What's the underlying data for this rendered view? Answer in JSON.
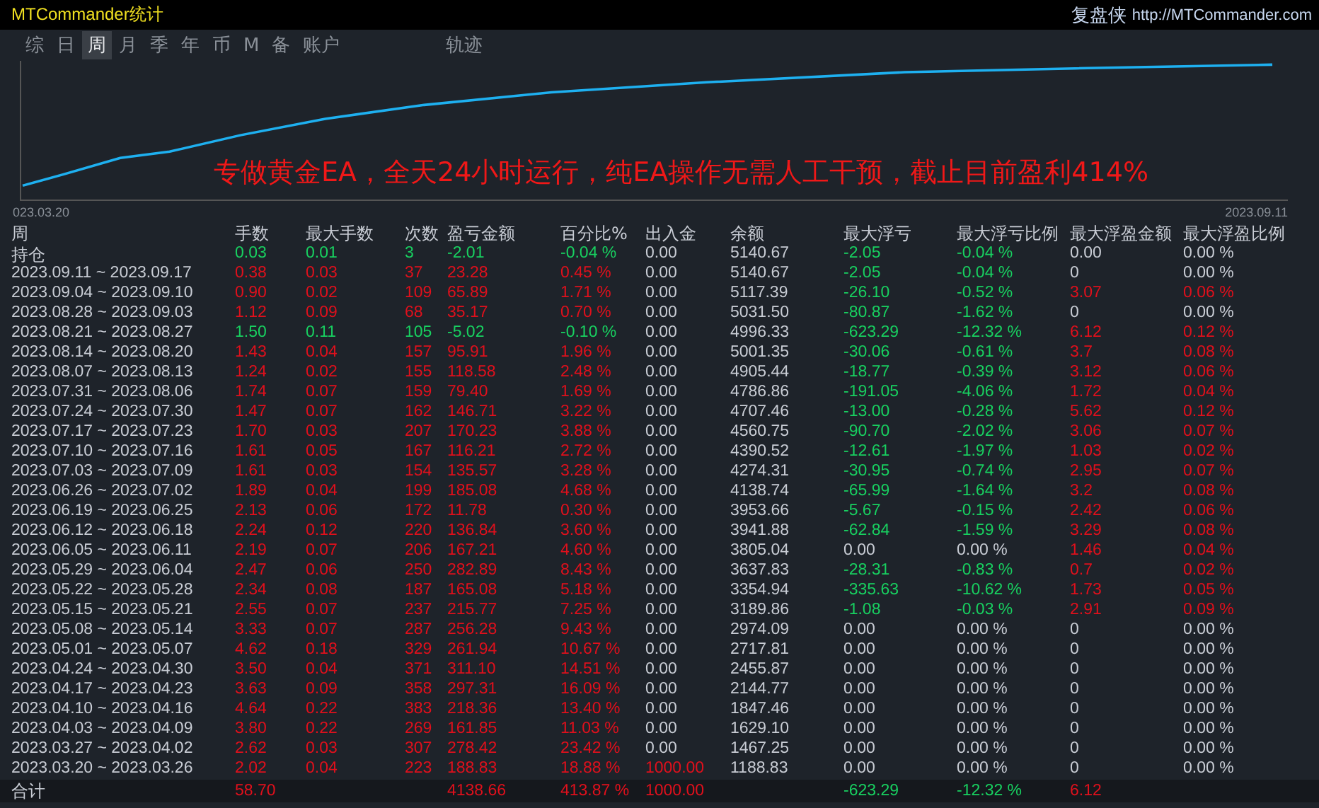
{
  "window": {
    "title": "MTCommander统计",
    "brand": "复盘侠",
    "url": "http://MTCommander.com"
  },
  "tabs": [
    {
      "label": "综",
      "selected": false
    },
    {
      "label": "日",
      "selected": false
    },
    {
      "label": "周",
      "selected": true
    },
    {
      "label": "月",
      "selected": false
    },
    {
      "label": "季",
      "selected": false
    },
    {
      "label": "年",
      "selected": false
    },
    {
      "label": "币",
      "selected": false
    },
    {
      "label": "M",
      "selected": false
    },
    {
      "label": "备",
      "selected": false
    },
    {
      "label": "账户",
      "selected": false
    },
    {
      "label": "轨迹",
      "selected": false
    }
  ],
  "chart": {
    "start_label": "023.03.20",
    "end_label": "2023.09.11",
    "banner": "专做黄金EA，全天24小时运行，纯EA操作无需人工干预，截止目前盈利414%"
  },
  "table": {
    "period_header": "周",
    "columns": [
      "手数",
      "最大手数",
      "次数",
      "盈亏金额",
      "百分比%",
      "出入金",
      "余额",
      "最大浮亏",
      "最大浮亏比例",
      "最大浮盈金额",
      "最大浮盈比例"
    ],
    "rows": [
      {
        "period": "持仓",
        "cells": [
          {
            "text": "0.03",
            "color": "#18d060"
          },
          {
            "text": "0.01",
            "color": "#18d060"
          },
          {
            "text": "3",
            "color": "#18d060"
          },
          {
            "text": "-2.01",
            "color": "#18d060"
          },
          {
            "text": "-0.04 %",
            "color": "#18d060"
          },
          {
            "text": "0.00",
            "color": "#c8ccd4"
          },
          {
            "text": "5140.67",
            "color": "#c8ccd4"
          },
          {
            "text": "-2.05",
            "color": "#18d060"
          },
          {
            "text": "-0.04 %",
            "color": "#18d060"
          },
          {
            "text": "0.00",
            "color": "#c8ccd4"
          },
          {
            "text": "0.00 %",
            "color": "#c8ccd4"
          }
        ]
      },
      {
        "period": "2023.09.11 ~ 2023.09.17",
        "cells": [
          {
            "text": "0.38",
            "color": "#e0101c"
          },
          {
            "text": "0.03",
            "color": "#e0101c"
          },
          {
            "text": "37",
            "color": "#e0101c"
          },
          {
            "text": "23.28",
            "color": "#e0101c"
          },
          {
            "text": "0.45 %",
            "color": "#e0101c"
          },
          {
            "text": "0.00",
            "color": "#c8ccd4"
          },
          {
            "text": "5140.67",
            "color": "#c8ccd4"
          },
          {
            "text": "-2.05",
            "color": "#18d060"
          },
          {
            "text": "-0.04 %",
            "color": "#18d060"
          },
          {
            "text": "0",
            "color": "#c8ccd4"
          },
          {
            "text": "0.00 %",
            "color": "#c8ccd4"
          }
        ]
      },
      {
        "period": "2023.09.04 ~ 2023.09.10",
        "cells": [
          {
            "text": "0.90",
            "color": "#e0101c"
          },
          {
            "text": "0.02",
            "color": "#e0101c"
          },
          {
            "text": "109",
            "color": "#e0101c"
          },
          {
            "text": "65.89",
            "color": "#e0101c"
          },
          {
            "text": "1.71 %",
            "color": "#e0101c"
          },
          {
            "text": "0.00",
            "color": "#c8ccd4"
          },
          {
            "text": "5117.39",
            "color": "#c8ccd4"
          },
          {
            "text": "-26.10",
            "color": "#18d060"
          },
          {
            "text": "-0.52 %",
            "color": "#18d060"
          },
          {
            "text": "3.07",
            "color": "#e0101c"
          },
          {
            "text": "0.06 %",
            "color": "#e0101c"
          }
        ]
      },
      {
        "period": "2023.08.28 ~ 2023.09.03",
        "cells": [
          {
            "text": "1.12",
            "color": "#e0101c"
          },
          {
            "text": "0.09",
            "color": "#e0101c"
          },
          {
            "text": "68",
            "color": "#e0101c"
          },
          {
            "text": "35.17",
            "color": "#e0101c"
          },
          {
            "text": "0.70 %",
            "color": "#e0101c"
          },
          {
            "text": "0.00",
            "color": "#c8ccd4"
          },
          {
            "text": "5031.50",
            "color": "#c8ccd4"
          },
          {
            "text": "-80.87",
            "color": "#18d060"
          },
          {
            "text": "-1.62 %",
            "color": "#18d060"
          },
          {
            "text": "0",
            "color": "#c8ccd4"
          },
          {
            "text": "0.00 %",
            "color": "#c8ccd4"
          }
        ]
      },
      {
        "period": "2023.08.21 ~ 2023.08.27",
        "cells": [
          {
            "text": "1.50",
            "color": "#18d060"
          },
          {
            "text": "0.11",
            "color": "#18d060"
          },
          {
            "text": "105",
            "color": "#18d060"
          },
          {
            "text": "-5.02",
            "color": "#18d060"
          },
          {
            "text": "-0.10 %",
            "color": "#18d060"
          },
          {
            "text": "0.00",
            "color": "#c8ccd4"
          },
          {
            "text": "4996.33",
            "color": "#c8ccd4"
          },
          {
            "text": "-623.29",
            "color": "#18d060"
          },
          {
            "text": "-12.32 %",
            "color": "#18d060"
          },
          {
            "text": "6.12",
            "color": "#e0101c"
          },
          {
            "text": "0.12 %",
            "color": "#e0101c"
          }
        ]
      },
      {
        "period": "2023.08.14 ~ 2023.08.20",
        "cells": [
          {
            "text": "1.43",
            "color": "#e0101c"
          },
          {
            "text": "0.04",
            "color": "#e0101c"
          },
          {
            "text": "157",
            "color": "#e0101c"
          },
          {
            "text": "95.91",
            "color": "#e0101c"
          },
          {
            "text": "1.96 %",
            "color": "#e0101c"
          },
          {
            "text": "0.00",
            "color": "#c8ccd4"
          },
          {
            "text": "5001.35",
            "color": "#c8ccd4"
          },
          {
            "text": "-30.06",
            "color": "#18d060"
          },
          {
            "text": "-0.61 %",
            "color": "#18d060"
          },
          {
            "text": "3.7",
            "color": "#e0101c"
          },
          {
            "text": "0.08 %",
            "color": "#e0101c"
          }
        ]
      },
      {
        "period": "2023.08.07 ~ 2023.08.13",
        "cells": [
          {
            "text": "1.24",
            "color": "#e0101c"
          },
          {
            "text": "0.02",
            "color": "#e0101c"
          },
          {
            "text": "155",
            "color": "#e0101c"
          },
          {
            "text": "118.58",
            "color": "#e0101c"
          },
          {
            "text": "2.48 %",
            "color": "#e0101c"
          },
          {
            "text": "0.00",
            "color": "#c8ccd4"
          },
          {
            "text": "4905.44",
            "color": "#c8ccd4"
          },
          {
            "text": "-18.77",
            "color": "#18d060"
          },
          {
            "text": "-0.39 %",
            "color": "#18d060"
          },
          {
            "text": "3.12",
            "color": "#e0101c"
          },
          {
            "text": "0.06 %",
            "color": "#e0101c"
          }
        ]
      },
      {
        "period": "2023.07.31 ~ 2023.08.06",
        "cells": [
          {
            "text": "1.74",
            "color": "#e0101c"
          },
          {
            "text": "0.07",
            "color": "#e0101c"
          },
          {
            "text": "159",
            "color": "#e0101c"
          },
          {
            "text": "79.40",
            "color": "#e0101c"
          },
          {
            "text": "1.69 %",
            "color": "#e0101c"
          },
          {
            "text": "0.00",
            "color": "#c8ccd4"
          },
          {
            "text": "4786.86",
            "color": "#c8ccd4"
          },
          {
            "text": "-191.05",
            "color": "#18d060"
          },
          {
            "text": "-4.06 %",
            "color": "#18d060"
          },
          {
            "text": "1.72",
            "color": "#e0101c"
          },
          {
            "text": "0.04 %",
            "color": "#e0101c"
          }
        ]
      },
      {
        "period": "2023.07.24 ~ 2023.07.30",
        "cells": [
          {
            "text": "1.47",
            "color": "#e0101c"
          },
          {
            "text": "0.07",
            "color": "#e0101c"
          },
          {
            "text": "162",
            "color": "#e0101c"
          },
          {
            "text": "146.71",
            "color": "#e0101c"
          },
          {
            "text": "3.22 %",
            "color": "#e0101c"
          },
          {
            "text": "0.00",
            "color": "#c8ccd4"
          },
          {
            "text": "4707.46",
            "color": "#c8ccd4"
          },
          {
            "text": "-13.00",
            "color": "#18d060"
          },
          {
            "text": "-0.28 %",
            "color": "#18d060"
          },
          {
            "text": "5.62",
            "color": "#e0101c"
          },
          {
            "text": "0.12 %",
            "color": "#e0101c"
          }
        ]
      },
      {
        "period": "2023.07.17 ~ 2023.07.23",
        "cells": [
          {
            "text": "1.70",
            "color": "#e0101c"
          },
          {
            "text": "0.03",
            "color": "#e0101c"
          },
          {
            "text": "207",
            "color": "#e0101c"
          },
          {
            "text": "170.23",
            "color": "#e0101c"
          },
          {
            "text": "3.88 %",
            "color": "#e0101c"
          },
          {
            "text": "0.00",
            "color": "#c8ccd4"
          },
          {
            "text": "4560.75",
            "color": "#c8ccd4"
          },
          {
            "text": "-90.70",
            "color": "#18d060"
          },
          {
            "text": "-2.02 %",
            "color": "#18d060"
          },
          {
            "text": "3.06",
            "color": "#e0101c"
          },
          {
            "text": "0.07 %",
            "color": "#e0101c"
          }
        ]
      },
      {
        "period": "2023.07.10 ~ 2023.07.16",
        "cells": [
          {
            "text": "1.61",
            "color": "#e0101c"
          },
          {
            "text": "0.05",
            "color": "#e0101c"
          },
          {
            "text": "167",
            "color": "#e0101c"
          },
          {
            "text": "116.21",
            "color": "#e0101c"
          },
          {
            "text": "2.72 %",
            "color": "#e0101c"
          },
          {
            "text": "0.00",
            "color": "#c8ccd4"
          },
          {
            "text": "4390.52",
            "color": "#c8ccd4"
          },
          {
            "text": "-12.61",
            "color": "#18d060"
          },
          {
            "text": "-1.97 %",
            "color": "#18d060"
          },
          {
            "text": "1.03",
            "color": "#e0101c"
          },
          {
            "text": "0.02 %",
            "color": "#e0101c"
          }
        ]
      },
      {
        "period": "2023.07.03 ~ 2023.07.09",
        "cells": [
          {
            "text": "1.61",
            "color": "#e0101c"
          },
          {
            "text": "0.03",
            "color": "#e0101c"
          },
          {
            "text": "154",
            "color": "#e0101c"
          },
          {
            "text": "135.57",
            "color": "#e0101c"
          },
          {
            "text": "3.28 %",
            "color": "#e0101c"
          },
          {
            "text": "0.00",
            "color": "#c8ccd4"
          },
          {
            "text": "4274.31",
            "color": "#c8ccd4"
          },
          {
            "text": "-30.95",
            "color": "#18d060"
          },
          {
            "text": "-0.74 %",
            "color": "#18d060"
          },
          {
            "text": "2.95",
            "color": "#e0101c"
          },
          {
            "text": "0.07 %",
            "color": "#e0101c"
          }
        ]
      },
      {
        "period": "2023.06.26 ~ 2023.07.02",
        "cells": [
          {
            "text": "1.89",
            "color": "#e0101c"
          },
          {
            "text": "0.04",
            "color": "#e0101c"
          },
          {
            "text": "199",
            "color": "#e0101c"
          },
          {
            "text": "185.08",
            "color": "#e0101c"
          },
          {
            "text": "4.68 %",
            "color": "#e0101c"
          },
          {
            "text": "0.00",
            "color": "#c8ccd4"
          },
          {
            "text": "4138.74",
            "color": "#c8ccd4"
          },
          {
            "text": "-65.99",
            "color": "#18d060"
          },
          {
            "text": "-1.64 %",
            "color": "#18d060"
          },
          {
            "text": "3.2",
            "color": "#e0101c"
          },
          {
            "text": "0.08 %",
            "color": "#e0101c"
          }
        ]
      },
      {
        "period": "2023.06.19 ~ 2023.06.25",
        "cells": [
          {
            "text": "2.13",
            "color": "#e0101c"
          },
          {
            "text": "0.06",
            "color": "#e0101c"
          },
          {
            "text": "172",
            "color": "#e0101c"
          },
          {
            "text": "11.78",
            "color": "#e0101c"
          },
          {
            "text": "0.30 %",
            "color": "#e0101c"
          },
          {
            "text": "0.00",
            "color": "#c8ccd4"
          },
          {
            "text": "3953.66",
            "color": "#c8ccd4"
          },
          {
            "text": "-5.67",
            "color": "#18d060"
          },
          {
            "text": "-0.15 %",
            "color": "#18d060"
          },
          {
            "text": "2.42",
            "color": "#e0101c"
          },
          {
            "text": "0.06 %",
            "color": "#e0101c"
          }
        ]
      },
      {
        "period": "2023.06.12 ~ 2023.06.18",
        "cells": [
          {
            "text": "2.24",
            "color": "#e0101c"
          },
          {
            "text": "0.12",
            "color": "#e0101c"
          },
          {
            "text": "220",
            "color": "#e0101c"
          },
          {
            "text": "136.84",
            "color": "#e0101c"
          },
          {
            "text": "3.60 %",
            "color": "#e0101c"
          },
          {
            "text": "0.00",
            "color": "#c8ccd4"
          },
          {
            "text": "3941.88",
            "color": "#c8ccd4"
          },
          {
            "text": "-62.84",
            "color": "#18d060"
          },
          {
            "text": "-1.59 %",
            "color": "#18d060"
          },
          {
            "text": "3.29",
            "color": "#e0101c"
          },
          {
            "text": "0.08 %",
            "color": "#e0101c"
          }
        ]
      },
      {
        "period": "2023.06.05 ~ 2023.06.11",
        "cells": [
          {
            "text": "2.19",
            "color": "#e0101c"
          },
          {
            "text": "0.07",
            "color": "#e0101c"
          },
          {
            "text": "206",
            "color": "#e0101c"
          },
          {
            "text": "167.21",
            "color": "#e0101c"
          },
          {
            "text": "4.60 %",
            "color": "#e0101c"
          },
          {
            "text": "0.00",
            "color": "#c8ccd4"
          },
          {
            "text": "3805.04",
            "color": "#c8ccd4"
          },
          {
            "text": "0.00",
            "color": "#c8ccd4"
          },
          {
            "text": "0.00 %",
            "color": "#c8ccd4"
          },
          {
            "text": "1.46",
            "color": "#e0101c"
          },
          {
            "text": "0.04 %",
            "color": "#e0101c"
          }
        ]
      },
      {
        "period": "2023.05.29 ~ 2023.06.04",
        "cells": [
          {
            "text": "2.47",
            "color": "#e0101c"
          },
          {
            "text": "0.06",
            "color": "#e0101c"
          },
          {
            "text": "250",
            "color": "#e0101c"
          },
          {
            "text": "282.89",
            "color": "#e0101c"
          },
          {
            "text": "8.43 %",
            "color": "#e0101c"
          },
          {
            "text": "0.00",
            "color": "#c8ccd4"
          },
          {
            "text": "3637.83",
            "color": "#c8ccd4"
          },
          {
            "text": "-28.31",
            "color": "#18d060"
          },
          {
            "text": "-0.83 %",
            "color": "#18d060"
          },
          {
            "text": "0.7",
            "color": "#e0101c"
          },
          {
            "text": "0.02 %",
            "color": "#e0101c"
          }
        ]
      },
      {
        "period": "2023.05.22 ~ 2023.05.28",
        "cells": [
          {
            "text": "2.34",
            "color": "#e0101c"
          },
          {
            "text": "0.08",
            "color": "#e0101c"
          },
          {
            "text": "187",
            "color": "#e0101c"
          },
          {
            "text": "165.08",
            "color": "#e0101c"
          },
          {
            "text": "5.18 %",
            "color": "#e0101c"
          },
          {
            "text": "0.00",
            "color": "#c8ccd4"
          },
          {
            "text": "3354.94",
            "color": "#c8ccd4"
          },
          {
            "text": "-335.63",
            "color": "#18d060"
          },
          {
            "text": "-10.62 %",
            "color": "#18d060"
          },
          {
            "text": "1.73",
            "color": "#e0101c"
          },
          {
            "text": "0.05 %",
            "color": "#e0101c"
          }
        ]
      },
      {
        "period": "2023.05.15 ~ 2023.05.21",
        "cells": [
          {
            "text": "2.55",
            "color": "#e0101c"
          },
          {
            "text": "0.07",
            "color": "#e0101c"
          },
          {
            "text": "237",
            "color": "#e0101c"
          },
          {
            "text": "215.77",
            "color": "#e0101c"
          },
          {
            "text": "7.25 %",
            "color": "#e0101c"
          },
          {
            "text": "0.00",
            "color": "#c8ccd4"
          },
          {
            "text": "3189.86",
            "color": "#c8ccd4"
          },
          {
            "text": "-1.08",
            "color": "#18d060"
          },
          {
            "text": "-0.03 %",
            "color": "#18d060"
          },
          {
            "text": "2.91",
            "color": "#e0101c"
          },
          {
            "text": "0.09 %",
            "color": "#e0101c"
          }
        ]
      },
      {
        "period": "2023.05.08 ~ 2023.05.14",
        "cells": [
          {
            "text": "3.33",
            "color": "#e0101c"
          },
          {
            "text": "0.07",
            "color": "#e0101c"
          },
          {
            "text": "287",
            "color": "#e0101c"
          },
          {
            "text": "256.28",
            "color": "#e0101c"
          },
          {
            "text": "9.43 %",
            "color": "#e0101c"
          },
          {
            "text": "0.00",
            "color": "#c8ccd4"
          },
          {
            "text": "2974.09",
            "color": "#c8ccd4"
          },
          {
            "text": "0.00",
            "color": "#c8ccd4"
          },
          {
            "text": "0.00 %",
            "color": "#c8ccd4"
          },
          {
            "text": "0",
            "color": "#c8ccd4"
          },
          {
            "text": "0.00 %",
            "color": "#c8ccd4"
          }
        ]
      },
      {
        "period": "2023.05.01 ~ 2023.05.07",
        "cells": [
          {
            "text": "4.62",
            "color": "#e0101c"
          },
          {
            "text": "0.18",
            "color": "#e0101c"
          },
          {
            "text": "329",
            "color": "#e0101c"
          },
          {
            "text": "261.94",
            "color": "#e0101c"
          },
          {
            "text": "10.67 %",
            "color": "#e0101c"
          },
          {
            "text": "0.00",
            "color": "#c8ccd4"
          },
          {
            "text": "2717.81",
            "color": "#c8ccd4"
          },
          {
            "text": "0.00",
            "color": "#c8ccd4"
          },
          {
            "text": "0.00 %",
            "color": "#c8ccd4"
          },
          {
            "text": "0",
            "color": "#c8ccd4"
          },
          {
            "text": "0.00 %",
            "color": "#c8ccd4"
          }
        ]
      },
      {
        "period": "2023.04.24 ~ 2023.04.30",
        "cells": [
          {
            "text": "3.50",
            "color": "#e0101c"
          },
          {
            "text": "0.04",
            "color": "#e0101c"
          },
          {
            "text": "371",
            "color": "#e0101c"
          },
          {
            "text": "311.10",
            "color": "#e0101c"
          },
          {
            "text": "14.51 %",
            "color": "#e0101c"
          },
          {
            "text": "0.00",
            "color": "#c8ccd4"
          },
          {
            "text": "2455.87",
            "color": "#c8ccd4"
          },
          {
            "text": "0.00",
            "color": "#c8ccd4"
          },
          {
            "text": "0.00 %",
            "color": "#c8ccd4"
          },
          {
            "text": "0",
            "color": "#c8ccd4"
          },
          {
            "text": "0.00 %",
            "color": "#c8ccd4"
          }
        ]
      },
      {
        "period": "2023.04.17 ~ 2023.04.23",
        "cells": [
          {
            "text": "3.63",
            "color": "#e0101c"
          },
          {
            "text": "0.09",
            "color": "#e0101c"
          },
          {
            "text": "358",
            "color": "#e0101c"
          },
          {
            "text": "297.31",
            "color": "#e0101c"
          },
          {
            "text": "16.09 %",
            "color": "#e0101c"
          },
          {
            "text": "0.00",
            "color": "#c8ccd4"
          },
          {
            "text": "2144.77",
            "color": "#c8ccd4"
          },
          {
            "text": "0.00",
            "color": "#c8ccd4"
          },
          {
            "text": "0.00 %",
            "color": "#c8ccd4"
          },
          {
            "text": "0",
            "color": "#c8ccd4"
          },
          {
            "text": "0.00 %",
            "color": "#c8ccd4"
          }
        ]
      },
      {
        "period": "2023.04.10 ~ 2023.04.16",
        "cells": [
          {
            "text": "4.64",
            "color": "#e0101c"
          },
          {
            "text": "0.22",
            "color": "#e0101c"
          },
          {
            "text": "383",
            "color": "#e0101c"
          },
          {
            "text": "218.36",
            "color": "#e0101c"
          },
          {
            "text": "13.40 %",
            "color": "#e0101c"
          },
          {
            "text": "0.00",
            "color": "#c8ccd4"
          },
          {
            "text": "1847.46",
            "color": "#c8ccd4"
          },
          {
            "text": "0.00",
            "color": "#c8ccd4"
          },
          {
            "text": "0.00 %",
            "color": "#c8ccd4"
          },
          {
            "text": "0",
            "color": "#c8ccd4"
          },
          {
            "text": "0.00 %",
            "color": "#c8ccd4"
          }
        ]
      },
      {
        "period": "2023.04.03 ~ 2023.04.09",
        "cells": [
          {
            "text": "3.80",
            "color": "#e0101c"
          },
          {
            "text": "0.22",
            "color": "#e0101c"
          },
          {
            "text": "269",
            "color": "#e0101c"
          },
          {
            "text": "161.85",
            "color": "#e0101c"
          },
          {
            "text": "11.03 %",
            "color": "#e0101c"
          },
          {
            "text": "0.00",
            "color": "#c8ccd4"
          },
          {
            "text": "1629.10",
            "color": "#c8ccd4"
          },
          {
            "text": "0.00",
            "color": "#c8ccd4"
          },
          {
            "text": "0.00 %",
            "color": "#c8ccd4"
          },
          {
            "text": "0",
            "color": "#c8ccd4"
          },
          {
            "text": "0.00 %",
            "color": "#c8ccd4"
          }
        ]
      },
      {
        "period": "2023.03.27 ~ 2023.04.02",
        "cells": [
          {
            "text": "2.62",
            "color": "#e0101c"
          },
          {
            "text": "0.03",
            "color": "#e0101c"
          },
          {
            "text": "307",
            "color": "#e0101c"
          },
          {
            "text": "278.42",
            "color": "#e0101c"
          },
          {
            "text": "23.42 %",
            "color": "#e0101c"
          },
          {
            "text": "0.00",
            "color": "#c8ccd4"
          },
          {
            "text": "1467.25",
            "color": "#c8ccd4"
          },
          {
            "text": "0.00",
            "color": "#c8ccd4"
          },
          {
            "text": "0.00 %",
            "color": "#c8ccd4"
          },
          {
            "text": "0",
            "color": "#c8ccd4"
          },
          {
            "text": "0.00 %",
            "color": "#c8ccd4"
          }
        ]
      },
      {
        "period": "2023.03.20 ~ 2023.03.26",
        "cells": [
          {
            "text": "2.02",
            "color": "#e0101c"
          },
          {
            "text": "0.04",
            "color": "#e0101c"
          },
          {
            "text": "223",
            "color": "#e0101c"
          },
          {
            "text": "188.83",
            "color": "#e0101c"
          },
          {
            "text": "18.88 %",
            "color": "#e0101c"
          },
          {
            "text": "1000.00",
            "color": "#e0101c"
          },
          {
            "text": "1188.83",
            "color": "#c8ccd4"
          },
          {
            "text": "0.00",
            "color": "#c8ccd4"
          },
          {
            "text": "0.00 %",
            "color": "#c8ccd4"
          },
          {
            "text": "0",
            "color": "#c8ccd4"
          },
          {
            "text": "0.00 %",
            "color": "#c8ccd4"
          }
        ]
      }
    ],
    "total": {
      "label": "合计",
      "lots": {
        "text": "58.70",
        "color": "#e0101c"
      },
      "profit": {
        "text": "4138.66",
        "color": "#e0101c"
      },
      "percent": {
        "text": "413.87 %",
        "color": "#e0101c"
      },
      "deposit": {
        "text": "1000.00",
        "color": "#e0101c"
      },
      "max_float_loss": {
        "text": "-623.29",
        "color": "#18d060"
      },
      "max_float_loss_ratio": {
        "text": "-12.32 %",
        "color": "#18d060"
      },
      "max_float_profit": {
        "text": "6.12",
        "color": "#e0101c"
      }
    }
  }
}
